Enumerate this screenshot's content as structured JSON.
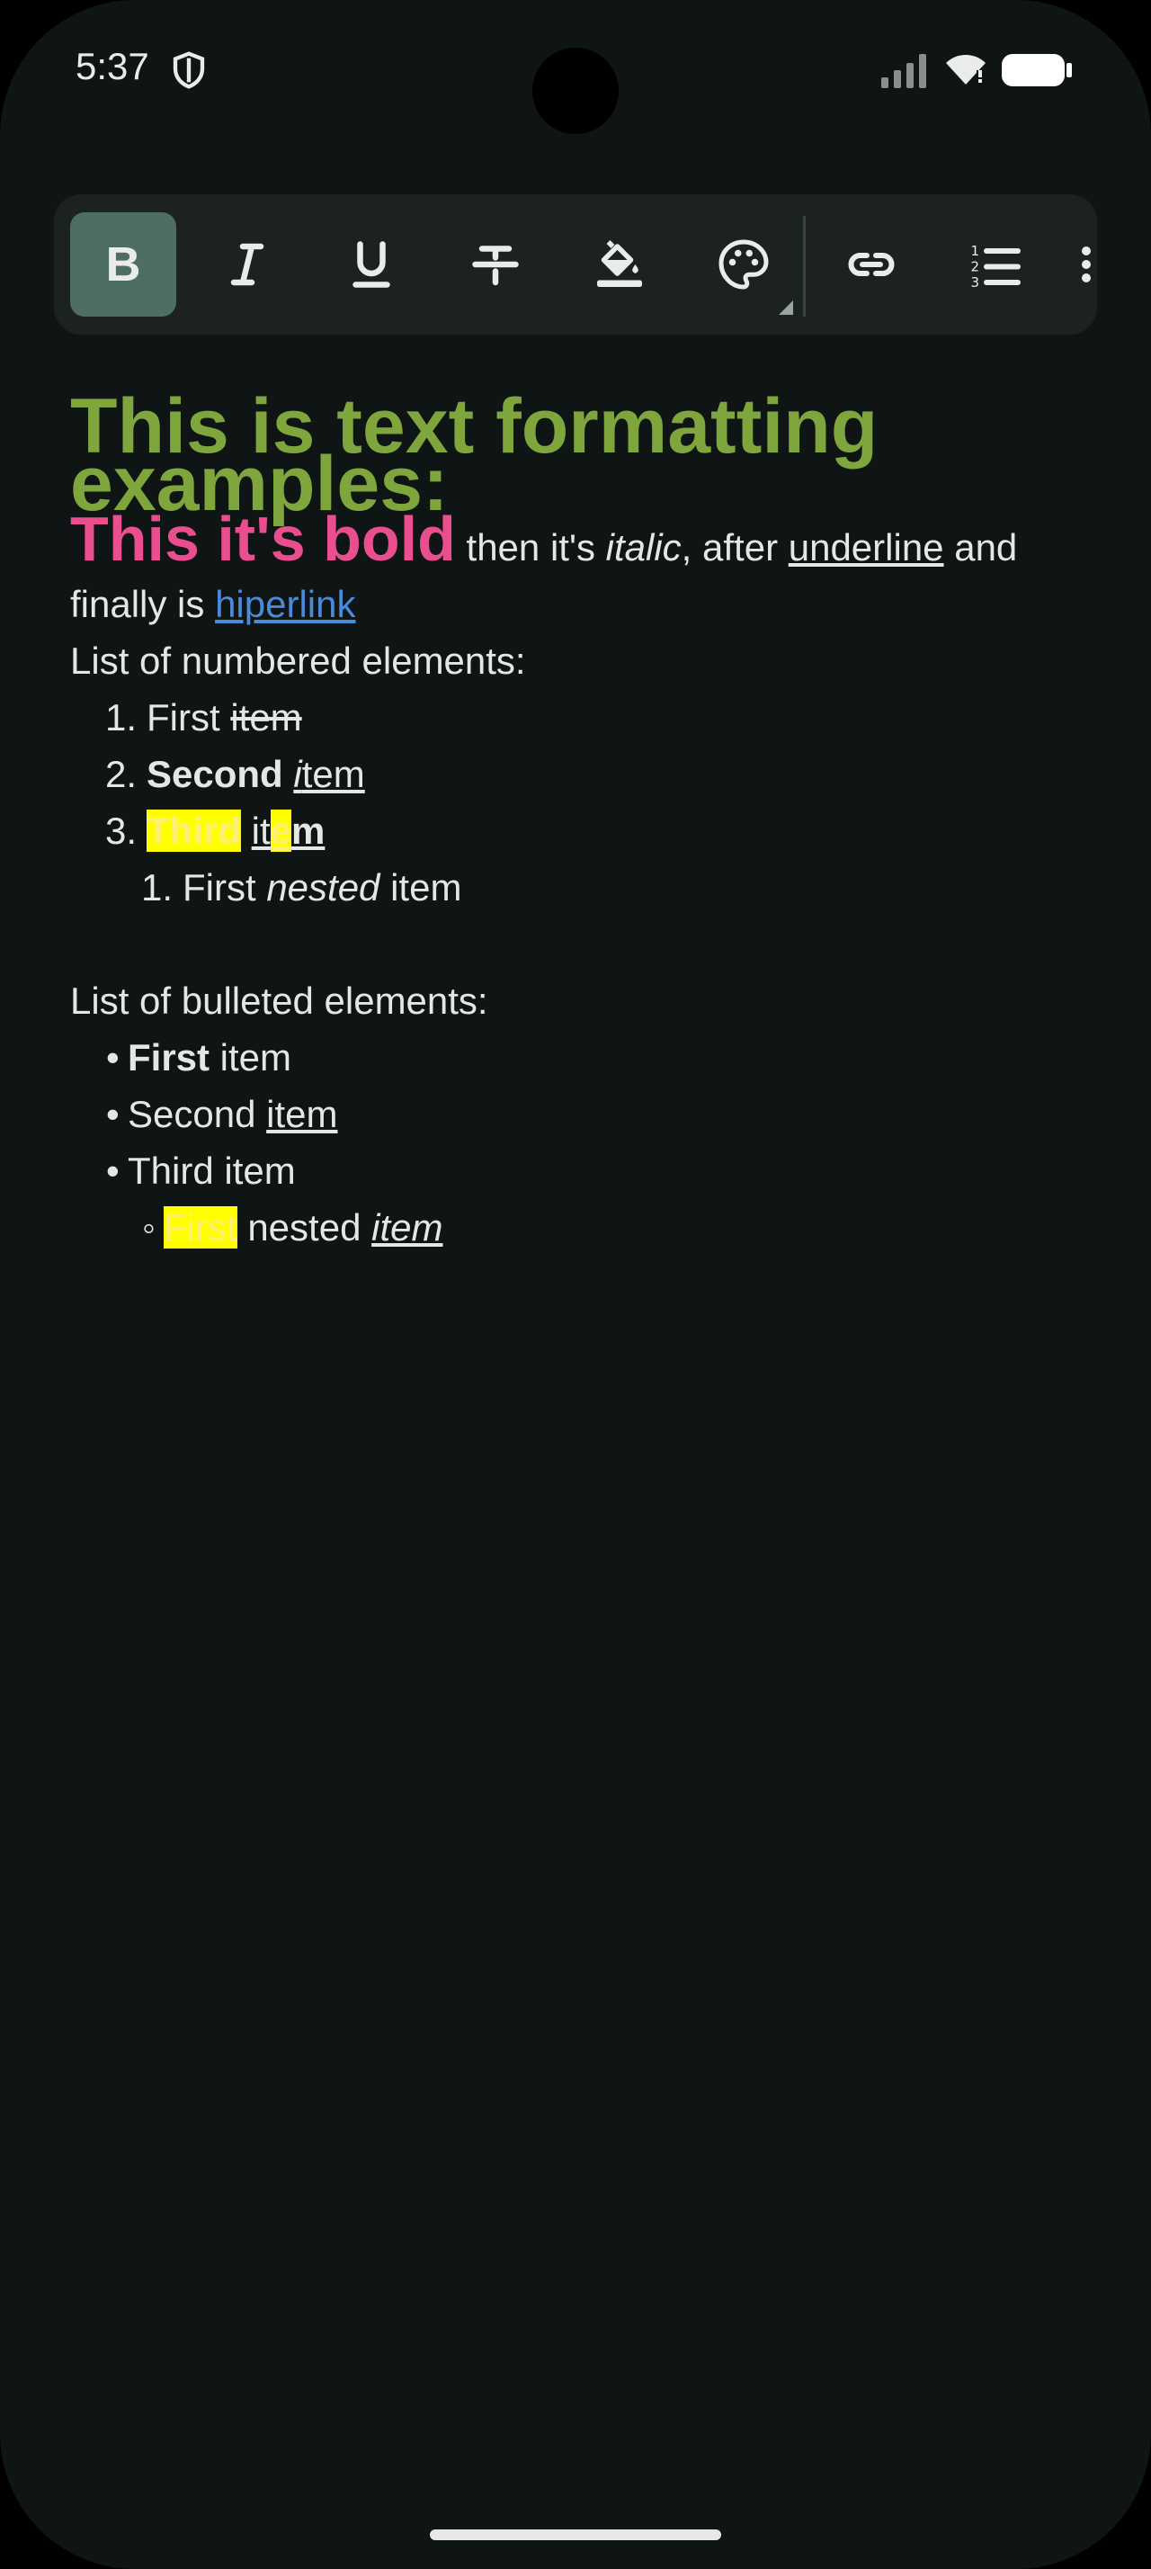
{
  "status_bar": {
    "time": "5:37"
  },
  "toolbar": {
    "buttons": [
      {
        "name": "bold",
        "active": true
      },
      {
        "name": "italic"
      },
      {
        "name": "underline"
      },
      {
        "name": "strikethrough"
      },
      {
        "name": "highlight-color"
      },
      {
        "name": "text-color"
      },
      {
        "name": "link"
      },
      {
        "name": "numbered-list"
      },
      {
        "name": "more"
      }
    ],
    "bold_label": "B"
  },
  "editor": {
    "title_line1": "This is text formatting",
    "title_line2": "examples:",
    "para": {
      "bold": "This it's bold",
      "t1": " then it's ",
      "italic": "italic",
      "t2": ", after ",
      "underline": "underline",
      "t3": " and",
      "t4": "finally is ",
      "link": "hiperlink"
    },
    "numbered_heading": "List of numbered elements:",
    "numbered": {
      "n1": "1.",
      "i1a": "First ",
      "i1b": "item",
      "n2": "2.",
      "i2a": "Second",
      "i2b": " ",
      "i2c": "i",
      "i2d": "tem",
      "n3": "3.",
      "i3a": "Third",
      "i3b": " ",
      "i3c": "it",
      "i3d": "e",
      "i3e": "m",
      "nested_n": "1.",
      "nested_a": "First ",
      "nested_b": "nested",
      "nested_c": " item"
    },
    "bulleted_heading": "List of bulleted elements:",
    "bulleted": {
      "b1a": "First",
      "b1b": " item",
      "b2a": "Second ",
      "b2b": "item",
      "b3": "Third item",
      "nested_a": "First",
      "nested_b": " nested ",
      "nested_c": "item"
    },
    "bullet": "•",
    "sub_bullet": "◦"
  },
  "colors": {
    "background": "#0f1514",
    "title": "#7fa63c",
    "bold_pink": "#e94f8e",
    "link": "#4a8ad8",
    "highlight": "#ffff00",
    "toolbar_active": "#4e6d64"
  }
}
